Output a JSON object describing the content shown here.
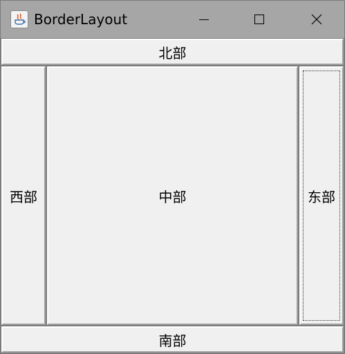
{
  "window": {
    "title": "BorderLayout",
    "icon": "java-coffee-cup-icon",
    "controls": {
      "minimize": "minimize-icon",
      "maximize": "maximize-icon",
      "close": "close-icon"
    }
  },
  "layout": {
    "north": "北部",
    "west": "西部",
    "center": "中部",
    "east": "东部",
    "south": "南部"
  },
  "colors": {
    "titlebar": "#a6a6a6",
    "panel": "#f0f0f0"
  }
}
